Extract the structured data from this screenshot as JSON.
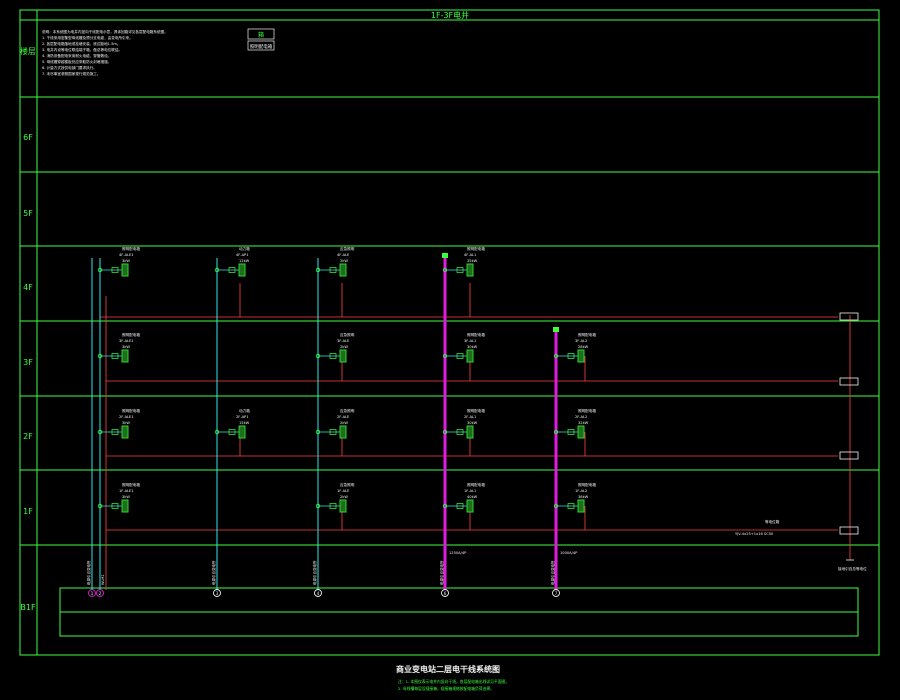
{
  "header": {
    "title": "1F-3F电井"
  },
  "floor_column": {
    "header_label": "楼层"
  },
  "floors": [
    {
      "label": "6F"
    },
    {
      "label": "5F"
    },
    {
      "label": "4F"
    },
    {
      "label": "3F"
    },
    {
      "label": "2F"
    },
    {
      "label": "1F"
    },
    {
      "label": "B1F"
    }
  ],
  "notes": {
    "lines": [
      "说明：本系统图为电井内竖向干线配电示意，具体回路详见各层配电箱系统图。",
      "1. 干线采用密集型母线槽及预分支电缆，由变电所引来。",
      "2. 各层配电箱落地或挂墙安装，底边距地1.5m。",
      "3. 电井内设等电位联结端子箱，做总等电位联结。",
      "4. 消防设备配电采用耐火电缆，穿管敷设。",
      "5. 母线槽穿越楼板处应采取防火封堵措施。",
      "6. 计量方式按供电部门要求执行。",
      "7. 未尽事宜参照国家现行规范施工。"
    ]
  },
  "legend": {
    "symbol_label": "箱",
    "caption": "照明配电箱"
  },
  "risers": [
    {
      "id": "1",
      "label": "WLM1"
    },
    {
      "id": "2",
      "label": "WLM2"
    },
    {
      "id": "3",
      "label": "WP1"
    },
    {
      "id": "4",
      "label": "WLE1"
    },
    {
      "id": "5",
      "label": "WPE1"
    },
    {
      "id": "6",
      "label": "BUS1"
    },
    {
      "id": "7",
      "label": "BUS2"
    }
  ],
  "riser_captions": [
    "电源引自变电所",
    "电源引自变电所",
    "电源引自变电所",
    "电源引自变电所",
    "电源引自变电所",
    "电源引自变电所"
  ],
  "busbar_notes": [
    "1250A/4P",
    "1000A/4P"
  ],
  "panels": {
    "row_4F": [
      {
        "name": "照明配电箱",
        "id": "4F-ALE1",
        "kw": "3kW"
      },
      {
        "name": "动力箱",
        "id": "4F-AP1",
        "kw": "12kW"
      },
      {
        "name": "应急照明",
        "id": "4F-ALE",
        "kw": "2kW"
      },
      {
        "name": "照明配电箱",
        "id": "4F-AL1",
        "kw": "35kW"
      }
    ],
    "row_3F": [
      {
        "name": "照明配电箱",
        "id": "3F-ALE1",
        "kw": "3kW"
      },
      {
        "name": "应急照明",
        "id": "3F-ALE",
        "kw": "2kW"
      },
      {
        "name": "照明配电箱",
        "id": "3F-AL1",
        "kw": "30kW"
      },
      {
        "name": "照明配电箱",
        "id": "3F-AL2",
        "kw": "28kW"
      }
    ],
    "row_2F": [
      {
        "name": "照明配电箱",
        "id": "2F-ALE1",
        "kw": "3kW"
      },
      {
        "name": "动力箱",
        "id": "2F-AP1",
        "kw": "15kW"
      },
      {
        "name": "应急照明",
        "id": "2F-ALE",
        "kw": "2kW"
      },
      {
        "name": "照明配电箱",
        "id": "2F-AL1",
        "kw": "30kW"
      },
      {
        "name": "照明配电箱",
        "id": "2F-AL2",
        "kw": "32kW"
      }
    ],
    "row_1F": [
      {
        "name": "照明配电箱",
        "id": "1F-ALE1",
        "kw": "3kW"
      },
      {
        "name": "应急照明",
        "id": "1F-ALE",
        "kw": "2kW"
      },
      {
        "name": "照明配电箱",
        "id": "1F-AL1",
        "kw": "40kW"
      },
      {
        "name": "照明配电箱",
        "id": "1F-AL2",
        "kw": "36kW"
      }
    ]
  },
  "riser_right": {
    "label": "等电位箱",
    "cable_note": "YJV-4x25+1x16 SC50"
  },
  "ground_note": "接地引自总等电位",
  "footer": {
    "title": "商业变电站二层电干线系统图",
    "notes": [
      "注：1. 本图仅表示电井内竖向干线，各层配电箱出线详见平面图。",
      "2. 母线槽每层设插接箱，插接箱规格按配电箱负荷选择。"
    ]
  },
  "colors": {
    "frame": "#3cff3c",
    "busbar": "#e01ce0",
    "riser_cyan": "#33e6e6",
    "feeder_red": "#ff4040",
    "panel_green": "#2bd62b",
    "text_white": "#f2f2f2"
  }
}
